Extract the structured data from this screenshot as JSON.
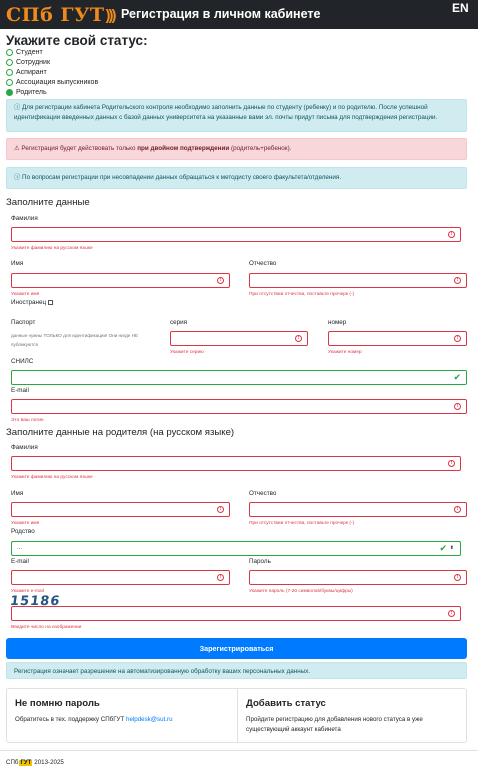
{
  "header": {
    "logo_text": "СПб ГУТ",
    "logo_waves": ")))",
    "title": "Регистрация в личном кабинете",
    "lang": "EN"
  },
  "status": {
    "heading": "Укажите свой статус:",
    "options": [
      "Студент",
      "Сотрудник",
      "Аспирант",
      "Ассоциация выпускников",
      "Родитель"
    ],
    "selected": "Родитель"
  },
  "alerts": {
    "info1": "Для регистрации кабинета Родительского контроля необходимо заполнить данные по студенту (ребенку) и по родителю. После успешной идентификации введенных данных с базой данных университета на указанные вами эл. почты придут письма для подтверждения регистрации.",
    "danger_pre": "Регистрация будет действовать только ",
    "danger_bold": "при двойном подтверждении",
    "danger_post": " (родитель+ребенок).",
    "info2": "По вопросам регистрации при несовпадении данных обращаться к методисту своего факультета/отделения."
  },
  "student": {
    "heading": "Заполните данные",
    "lastname_label": "Фамилия",
    "lastname_hint": "Укажите фамилию на русском языке",
    "firstname_label": "Имя",
    "firstname_hint": "Укажите имя",
    "middlename_label": "Отчество",
    "middlename_hint": "При отсутствии отчества, поставьте прочерк (-)",
    "foreigner_label": "Иностранец",
    "passport_label": "Паспорт",
    "passport_note": "данные нужны ТОЛЬКО для идентификации! Они нигде НЕ публикуются",
    "series_label": "серия",
    "series_hint": "Укажите серию",
    "number_label": "номер",
    "number_hint": "Укажите номер",
    "snils_label": "СНИЛС",
    "email_label": "E-mail",
    "email_hint": "Это ваш логин"
  },
  "parent": {
    "heading": "Заполните данные на родителя (на русском языке)",
    "lastname_label": "Фамилия",
    "lastname_hint": "Укажите фамилию на русском языке",
    "firstname_label": "Имя",
    "firstname_hint": "Укажите имя",
    "middlename_label": "Отчество",
    "middlename_hint": "При отсутствии отчества, поставьте прочерк (-)",
    "kinship_label": "Родство",
    "kinship_value": "...",
    "email_label": "E-mail",
    "email_hint": "Укажите e-mail",
    "password_label": "Пароль",
    "password_hint": "Укажите пароль (7-20 символов/буквы/цифры)",
    "captcha_text": "15186",
    "captcha_hint": "Введите число на изображении"
  },
  "submit_label": "Зарегистрироваться",
  "consent_text": "Регистрация означает разрешение на автоматизированную обработку ваших персональных данных.",
  "cards": {
    "forgot_title": "Не помню пароль",
    "forgot_text": "Обратитесь в тех. поддержку СПбГУТ",
    "forgot_email": "helpdesk@sut.ru",
    "add_title": "Добавить статус",
    "add_text": "Пройдите регистрацию для добавления нового статуса в уже существующий аккаунт кабинета"
  },
  "footer": {
    "spb": "СПб",
    "gut": "ГУТ",
    "years": "2013-2025"
  }
}
